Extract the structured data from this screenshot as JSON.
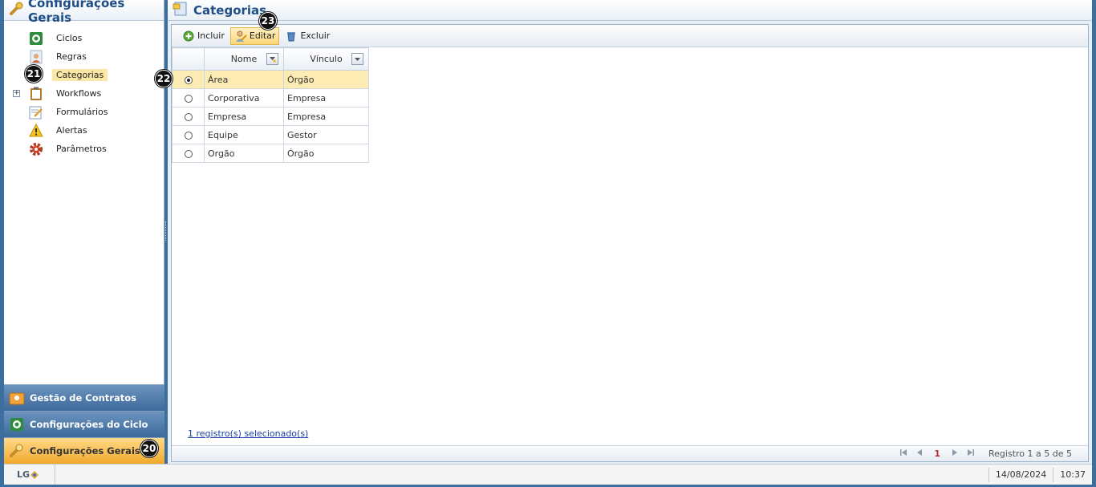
{
  "left_panel": {
    "title": "Configurações Gerais",
    "tree_items": [
      {
        "label": "Ciclos",
        "icon": "cycle-icon"
      },
      {
        "label": "Regras",
        "icon": "user-rules-icon"
      },
      {
        "label": "Categorias",
        "icon": "category-icon",
        "selected": true
      },
      {
        "label": "Workflows",
        "icon": "clipboard-icon",
        "expandable": true
      },
      {
        "label": "Formulários",
        "icon": "form-edit-icon"
      },
      {
        "label": "Alertas",
        "icon": "warning-icon"
      },
      {
        "label": "Parâmetros",
        "icon": "gear-icon"
      }
    ],
    "expand_symbol": "+",
    "bottom_nav": [
      {
        "label": "Gestão de Contratos",
        "icon": "contracts-icon"
      },
      {
        "label": "Configurações do Ciclo",
        "icon": "cycle-icon"
      },
      {
        "label": "Configurações Gerais",
        "icon": "wrench-icon",
        "active": true
      }
    ]
  },
  "right_panel": {
    "title": "Categorias",
    "toolbar": {
      "include_label": "Incluir",
      "edit_label": "Editar",
      "delete_label": "Excluir"
    },
    "grid": {
      "columns": [
        "Nome",
        "Vínculo"
      ],
      "rows": [
        {
          "nome": "Área",
          "vinculo": "Órgão",
          "selected": true
        },
        {
          "nome": "Corporativa",
          "vinculo": "Empresa",
          "selected": false
        },
        {
          "nome": "Empresa",
          "vinculo": "Empresa",
          "selected": false
        },
        {
          "nome": "Equipe",
          "vinculo": "Gestor",
          "selected": false
        },
        {
          "nome": "Orgão",
          "vinculo": "Órgão",
          "selected": false
        }
      ]
    },
    "selected_count_text": "1 registro(s) selecionado(s)",
    "pager": {
      "current_page": "1",
      "info": "Registro 1 a 5 de 5"
    }
  },
  "status_bar": {
    "logo_text": "LG",
    "date": "14/08/2024",
    "time": "10:37"
  },
  "markers": {
    "m20": "20",
    "m21": "21",
    "m22": "22",
    "m23": "23"
  },
  "colors": {
    "header_text": "#1f4e86",
    "selection": "#fcebb3",
    "active_nav": "#f1a92c",
    "nav_bg": "#3d6a9b"
  }
}
